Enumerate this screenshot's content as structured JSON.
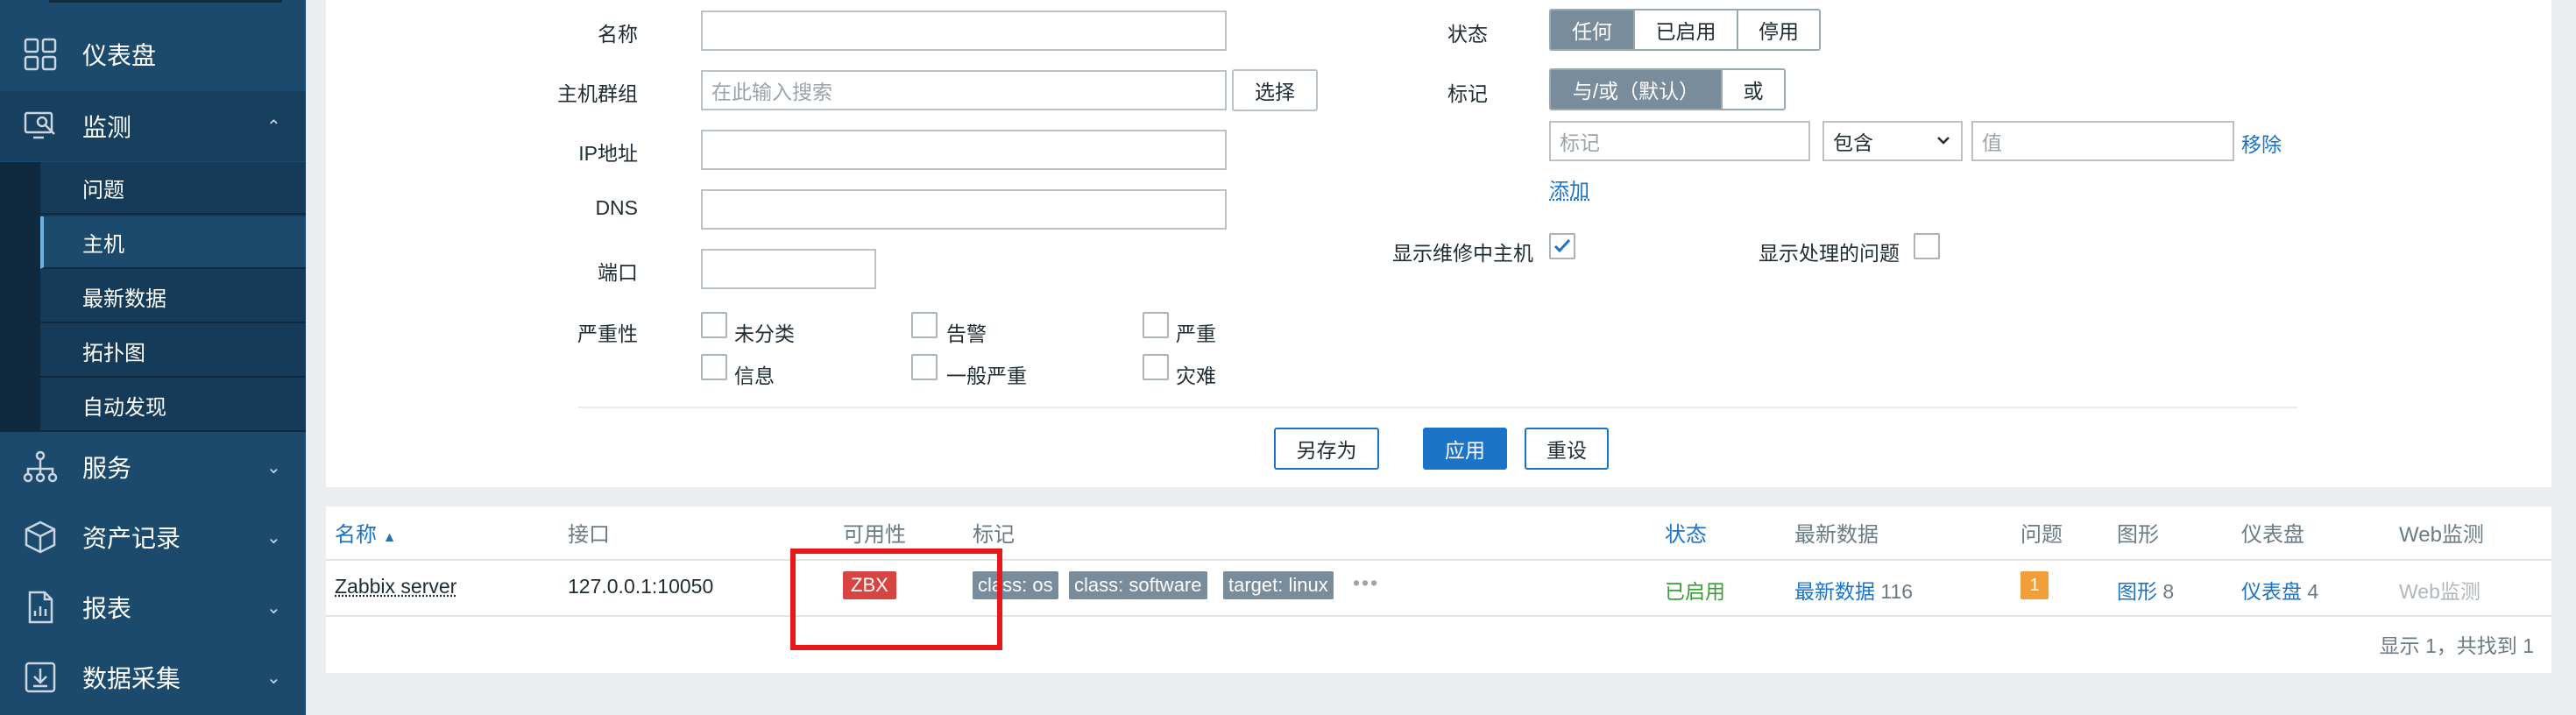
{
  "sidebar": {
    "items": [
      {
        "label": "仪表盘",
        "icon": "dashboard-grid-icon"
      },
      {
        "label": "监测",
        "icon": "monitoring-icon",
        "chevron": "⌃"
      },
      {
        "label": "服务",
        "icon": "services-tree-icon",
        "chevron": "⌄"
      },
      {
        "label": "资产记录",
        "icon": "inventory-box-icon",
        "chevron": "⌄"
      },
      {
        "label": "报表",
        "icon": "reports-document-icon",
        "chevron": "⌄"
      },
      {
        "label": "数据采集",
        "icon": "data-collection-icon",
        "chevron": "⌄"
      }
    ],
    "subitems": [
      "问题",
      "主机",
      "最新数据",
      "拓扑图",
      "自动发现"
    ]
  },
  "filter": {
    "name_label": "名称",
    "hostgroup_label": "主机群组",
    "hostgroup_placeholder": "在此输入搜索",
    "select_button": "选择",
    "ip_label": "IP地址",
    "dns_label": "DNS",
    "port_label": "端口",
    "severity_label": "严重性",
    "severities": [
      "未分类",
      "告警",
      "严重",
      "信息",
      "一般严重",
      "灾难"
    ],
    "status_label": "状态",
    "status_options": [
      "任何",
      "已启用",
      "停用"
    ],
    "tags_label": "标记",
    "tags_options": [
      "与/或（默认）",
      "或"
    ],
    "tag_placeholder": "标记",
    "tag_operator": "包含",
    "value_placeholder": "值",
    "remove_link": "移除",
    "add_link": "添加",
    "show_maintenance_label": "显示维修中主机",
    "show_suppressed_label": "显示处理的问题",
    "save_as_button": "另存为",
    "apply_button": "应用",
    "reset_button": "重设"
  },
  "table": {
    "headers": {
      "name": "名称",
      "interface": "接口",
      "availability": "可用性",
      "tags": "标记",
      "status": "状态",
      "latest_data": "最新数据",
      "problems": "问题",
      "graphs": "图形",
      "dashboards": "仪表盘",
      "web": "Web监测"
    },
    "sort_indicator": "▲",
    "row": {
      "name": "Zabbix server",
      "interface": "127.0.0.1:10050",
      "availability": "ZBX",
      "tags": [
        "class: os",
        "class: software",
        "target: linux"
      ],
      "more": "•••",
      "status": "已启用",
      "latest_data": "最新数据",
      "latest_data_count": "116",
      "problems": "1",
      "graphs": "图形",
      "graphs_count": "8",
      "dashboards": "仪表盘",
      "dashboards_count": "4",
      "web": "Web监测"
    },
    "footer": "显示 1，共找到 1"
  },
  "colors": {
    "sidebar": "#1b4a6d",
    "accent": "#1b74c8",
    "enabled_status": "#3c9d3c",
    "zbx_badge": "#d64541",
    "problem_badge": "#f29f3a",
    "highlight": "#e8171a"
  }
}
